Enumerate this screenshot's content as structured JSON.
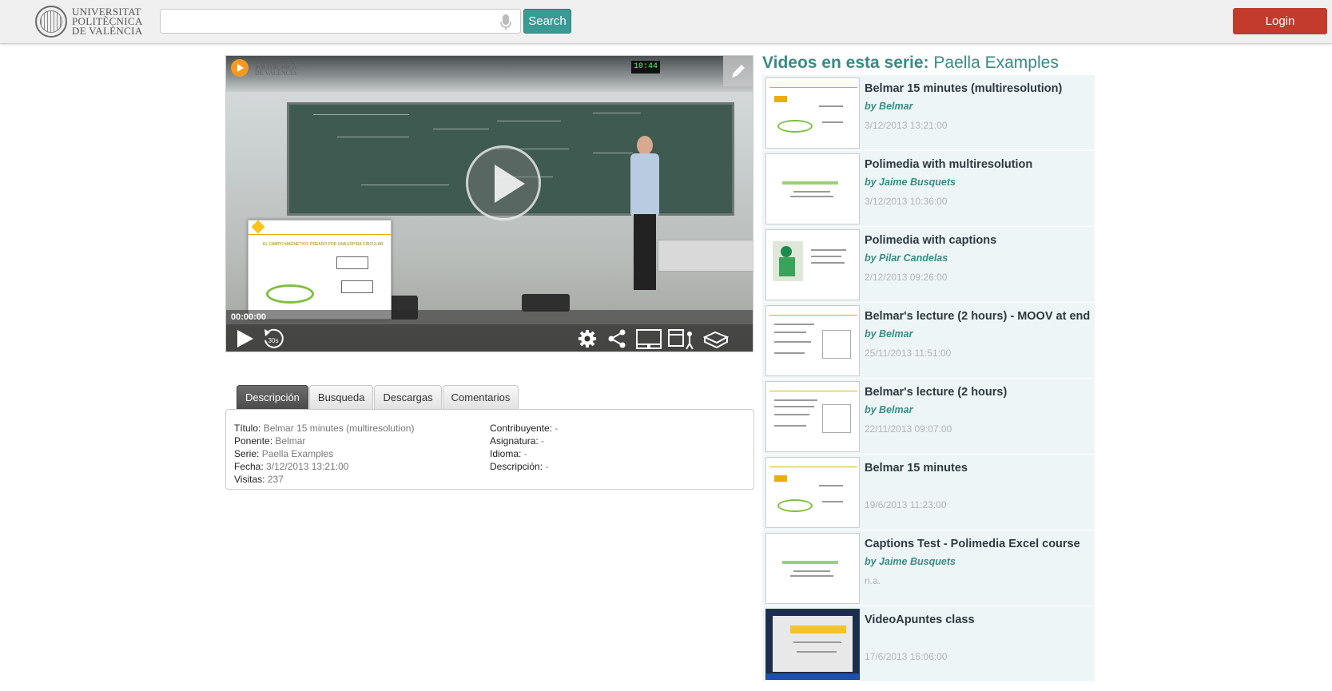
{
  "header": {
    "logo_lines": [
      "UNIVERSITAT",
      "POLITÈCNICA",
      "DE VALÈNCIA"
    ],
    "search_placeholder": "",
    "search_label": "Search",
    "login_label": "Login"
  },
  "player": {
    "timecode": "00:00:00",
    "clock": "10:44",
    "watermark_lines": [
      "UNIVERSITAT",
      "POLITÈCNICA",
      "DE VALÈNCIA"
    ],
    "slide_heading": "EL CAMPO MAGNÉTICO CREADO POR UNA ESPIRA CIRCULAR",
    "skip_label": "30s"
  },
  "tabs": [
    "Descripción",
    "Busqueda",
    "Descargas",
    "Comentarios"
  ],
  "info": {
    "left": [
      {
        "k": "Título:",
        "v": "Belmar 15 minutes (multiresolution)"
      },
      {
        "k": "Ponente:",
        "v": "Belmar"
      },
      {
        "k": "Serie:",
        "v": "Paella Examples"
      },
      {
        "k": "Fecha:",
        "v": "3/12/2013 13:21:00"
      },
      {
        "k": "Visitas:",
        "v": "237"
      }
    ],
    "right": [
      {
        "k": "Contribuyente:",
        "v": "-"
      },
      {
        "k": "Asignatura:",
        "v": "-"
      },
      {
        "k": "Idioma:",
        "v": "-"
      },
      {
        "k": "Descripción:",
        "v": "-"
      }
    ]
  },
  "sidebar": {
    "title_prefix": "Videos en esta serie:",
    "title_series": "Paella Examples",
    "items": [
      {
        "title": "Belmar 15 minutes (multiresolution)",
        "author": "by Belmar",
        "date": "3/12/2013 13:21:00",
        "thumb": "physics-slide"
      },
      {
        "title": "Polimedia with multiresolution",
        "author": "by Jaime Busquets",
        "date": "3/12/2013 10:36:00",
        "thumb": "green-slide"
      },
      {
        "title": "Polimedia with captions",
        "author": "by Pilar Candelas",
        "date": "2/12/2013 09:26:00",
        "thumb": "presenter-slide"
      },
      {
        "title": "Belmar's lecture (2 hours) - MOOV at end",
        "author": "by Belmar",
        "date": "25/11/2013 11:51:00",
        "thumb": "formula-slide"
      },
      {
        "title": "Belmar's lecture (2 hours)",
        "author": "by Belmar",
        "date": "22/11/2013 09:07:00",
        "thumb": "formula-slide"
      },
      {
        "title": "Belmar 15 minutes",
        "author": "",
        "date": "19/6/2013 11:23:00",
        "thumb": "physics-slide"
      },
      {
        "title": "Captions Test - Polimedia Excel course",
        "author": "by Jaime Busquets",
        "date": "n.a.",
        "thumb": "green-slide"
      },
      {
        "title": "VideoApuntes class",
        "author": "",
        "date": "17/6/2013 16:06:00",
        "thumb": "screen-capture"
      }
    ]
  },
  "colors": {
    "accent": "#3a9a94",
    "login": "#c23b2d",
    "series_title": "#3a8a84"
  }
}
